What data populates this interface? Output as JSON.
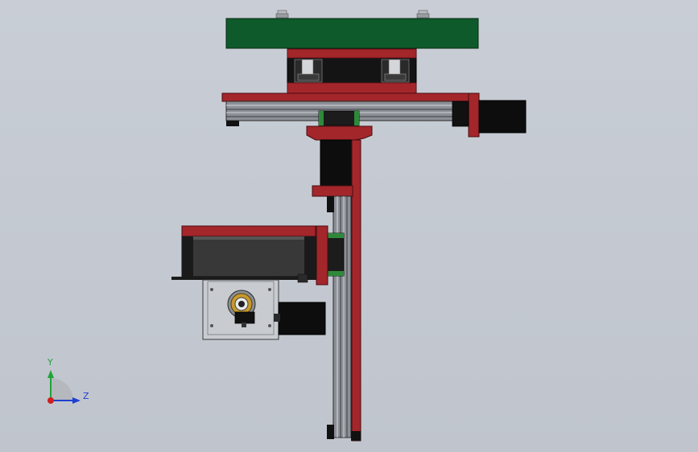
{
  "triad": {
    "y_label": "Y",
    "z_label": "Z",
    "colors": {
      "y_axis": "#1fa33a",
      "z_axis": "#1f3fd0",
      "origin": "#d01f1f"
    }
  },
  "colors": {
    "viewport_background": "#c6cbd3",
    "red_part": "#a3262b",
    "green_plate": "#0e5a2a",
    "black_part": "#101010",
    "aluminum": "#8c9096",
    "light_plate": "#c8cbd0"
  }
}
